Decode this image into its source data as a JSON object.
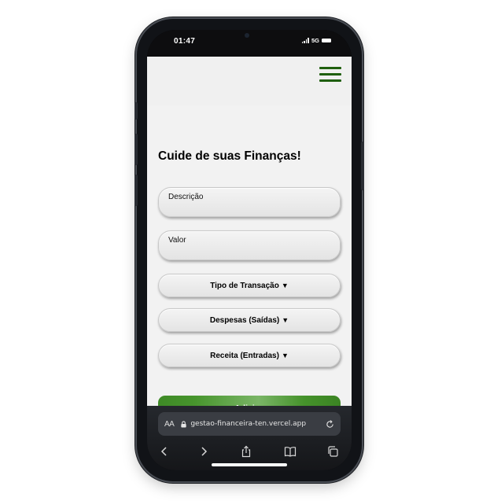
{
  "status_bar": {
    "time": "01:47",
    "network": "5G"
  },
  "header": {
    "menu_icon": "hamburger-menu-icon"
  },
  "page": {
    "title": "Cuide de suas Finanças!",
    "description_placeholder": "Descrição",
    "value_placeholder": "Valor",
    "selects": {
      "tipo": "Tipo de Transação",
      "despesas": "Despesas (Saídas)",
      "receita": "Receita (Entradas)",
      "caret": "▼"
    },
    "add_button": {
      "icon": "+",
      "label": "Adicionar"
    }
  },
  "browser": {
    "aa_label": "AA",
    "url": "gestao-financeira-ten.vercel.app",
    "toolbar_icons": [
      "back-icon",
      "forward-icon",
      "share-icon",
      "bookmarks-icon",
      "tabs-icon"
    ]
  },
  "colors": {
    "accent_green": "#3e8a26",
    "menu_green": "#1f5f0d",
    "page_bg": "#f2f2f2"
  }
}
